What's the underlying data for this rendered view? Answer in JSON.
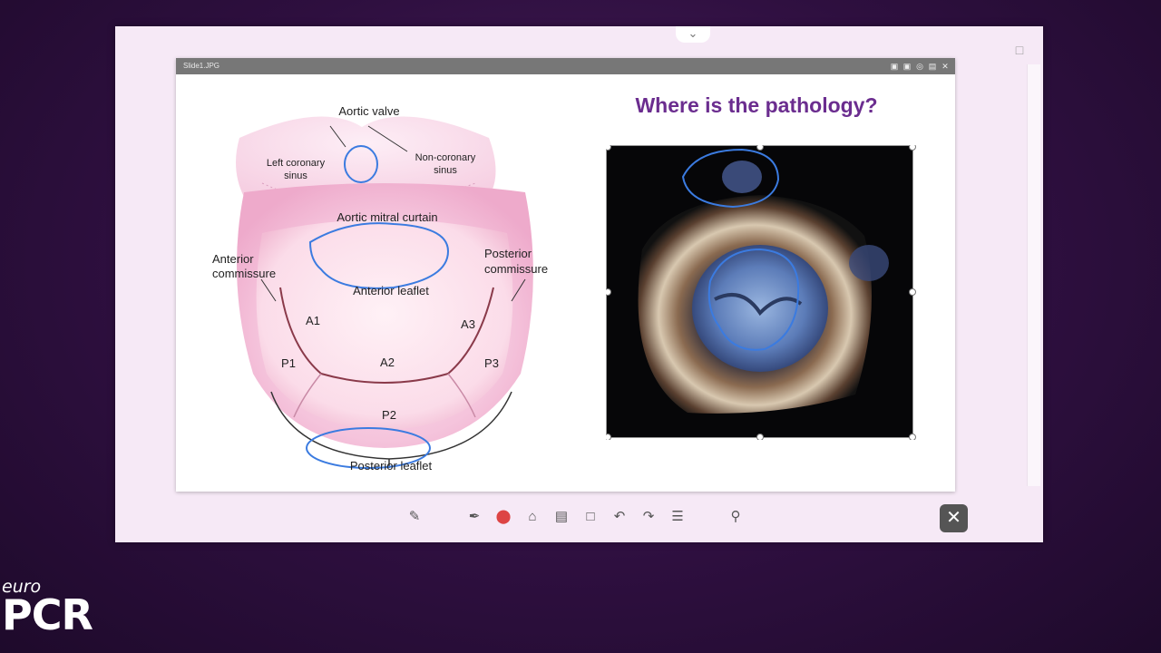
{
  "viewer": {
    "title": "Slide1.JPG",
    "title_icons": [
      "fit-icon",
      "rotate-icon",
      "zoom-icon",
      "save-icon",
      "close-icon"
    ]
  },
  "diagram": {
    "aortic_valve": "Aortic valve",
    "left_coronary_1": "Left coronary",
    "left_coronary_2": "sinus",
    "non_coronary_1": "Non-coronary",
    "non_coronary_2": "sinus",
    "aortic_mitral_curtain": "Aortic mitral curtain",
    "anterior_commissure_1": "Anterior",
    "anterior_commissure_2": "commissure",
    "posterior_commissure_1": "Posterior",
    "posterior_commissure_2": "commissure",
    "anterior_leaflet": "Anterior leaflet",
    "a1": "A1",
    "a2": "A2",
    "a3": "A3",
    "p1": "P1",
    "p2": "P2",
    "p3": "P3",
    "posterior_leaflet": "Posterior leaflet"
  },
  "slide": {
    "heading": "Where is the pathology?"
  },
  "toolbar": {
    "tools": [
      "note-icon",
      "pen-icon",
      "color-icon",
      "text-icon",
      "sticky-icon",
      "crop-icon",
      "undo-icon",
      "redo-icon",
      "menu-icon",
      "search-icon"
    ]
  },
  "logo": {
    "line1": "euro",
    "line2": "PCR"
  },
  "colors": {
    "heading": "#6b2d8f",
    "annotation": "#3b7be0",
    "background": "#2e0f3f"
  }
}
